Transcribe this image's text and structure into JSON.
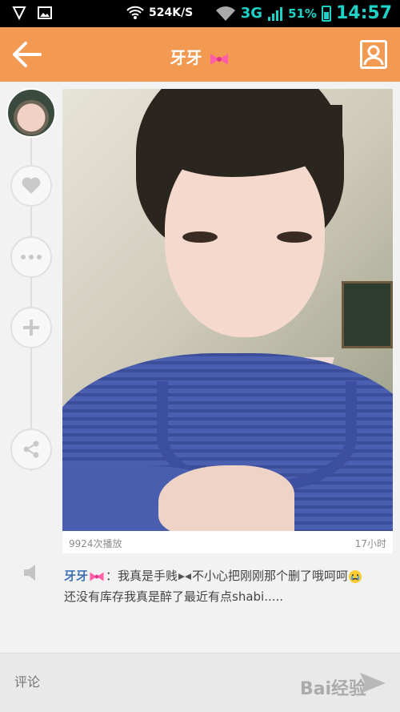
{
  "status_bar": {
    "speed": "524K/S",
    "network": "3G",
    "battery": "51%",
    "time": "14:57"
  },
  "header": {
    "title": "牙牙",
    "accent_color": "#f39a52"
  },
  "left_rail": {
    "icons": [
      "heart-icon",
      "more-icon",
      "plus-icon",
      "share-icon"
    ]
  },
  "post": {
    "play_count": "9924次播放",
    "time_ago": "17小时"
  },
  "caption": {
    "author": "牙牙",
    "line1": "：我真是手贱",
    "line1b": "不小心把刚刚那个删了哦呵呵",
    "line2": "还没有库存我真是醉了最近有点shabi....."
  },
  "comment": {
    "placeholder": "评论"
  },
  "watermark": "Bai经验"
}
